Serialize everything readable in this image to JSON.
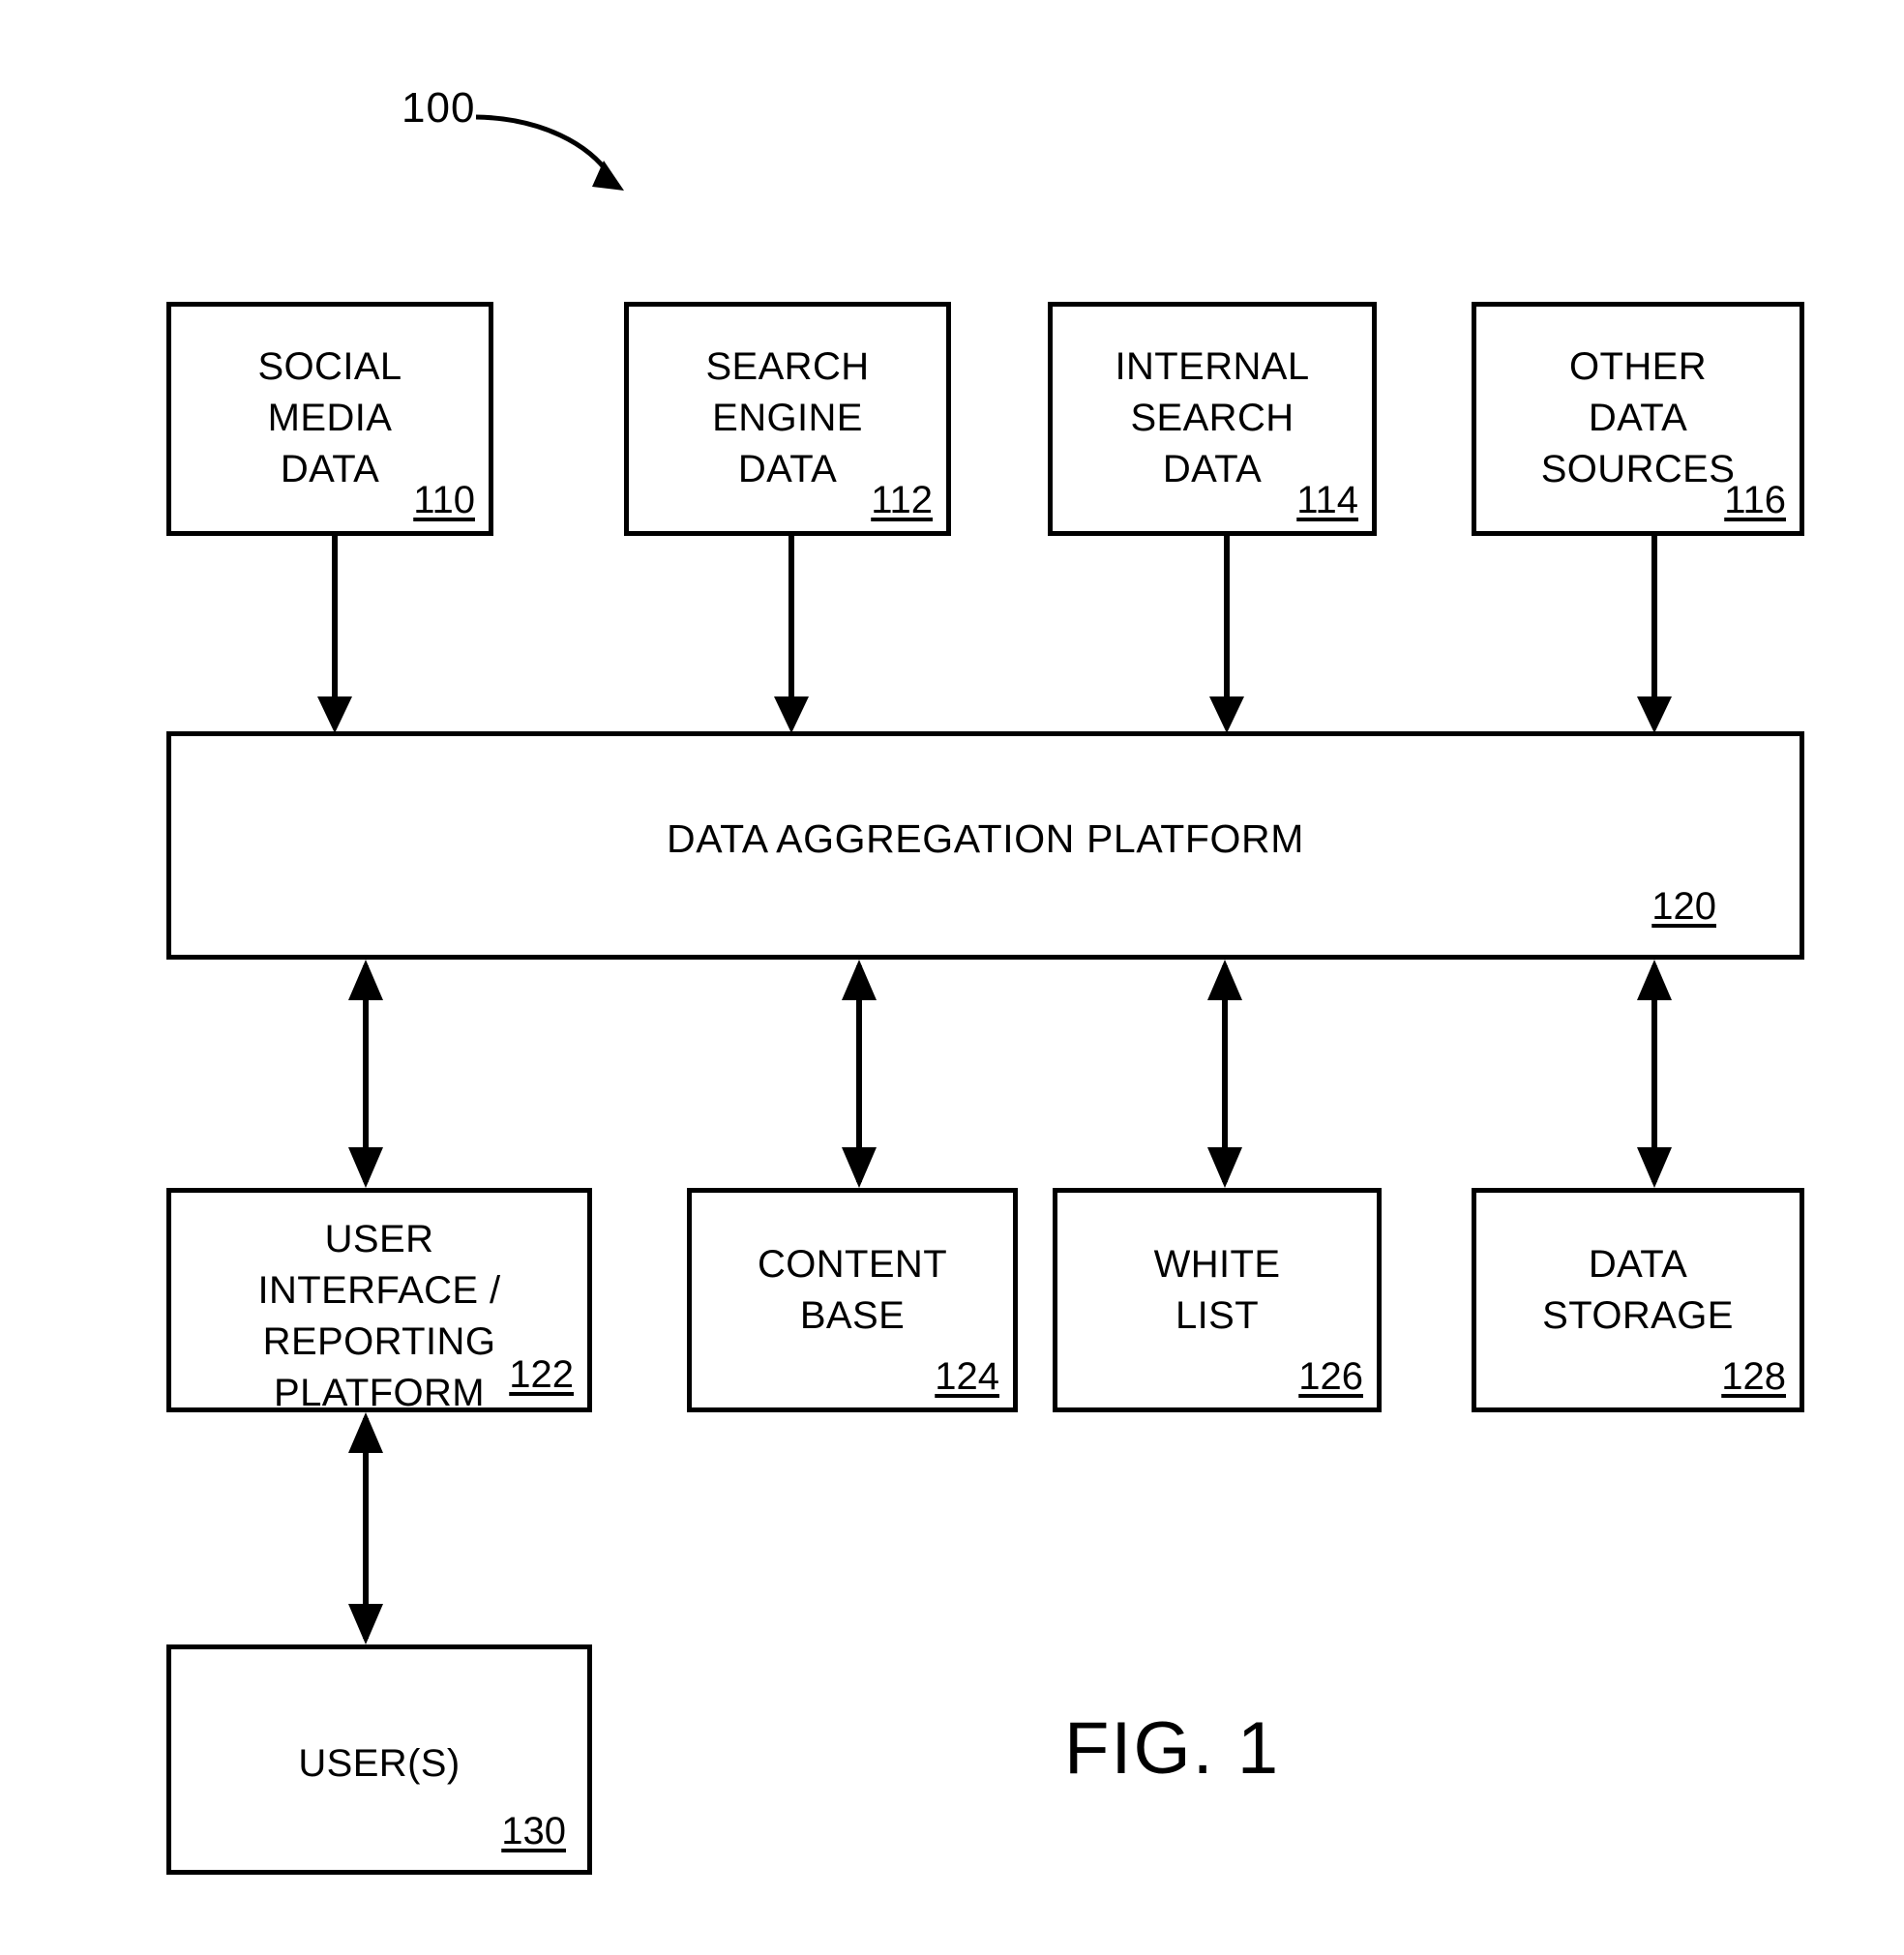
{
  "figure": {
    "caption": "FIG. 1",
    "system_callout": "100"
  },
  "sources": [
    {
      "label": "SOCIAL\nMEDIA\nDATA",
      "ref": "110"
    },
    {
      "label": "SEARCH\nENGINE\nDATA",
      "ref": "112"
    },
    {
      "label": "INTERNAL\nSEARCH\nDATA",
      "ref": "114"
    },
    {
      "label": "OTHER\nDATA\nSOURCES",
      "ref": "116"
    }
  ],
  "platform": {
    "label": "DATA AGGREGATION PLATFORM",
    "ref": "120"
  },
  "components": [
    {
      "label": "USER\nINTERFACE /\nREPORTING\nPLATFORM",
      "ref": "122"
    },
    {
      "label": "CONTENT\nBASE",
      "ref": "124"
    },
    {
      "label": "WHITE\nLIST",
      "ref": "126"
    },
    {
      "label": "DATA\nSTORAGE",
      "ref": "128"
    }
  ],
  "actor": {
    "label": "USER(S)",
    "ref": "130"
  },
  "colors": {
    "ink": "#000000",
    "paper": "#ffffff"
  }
}
